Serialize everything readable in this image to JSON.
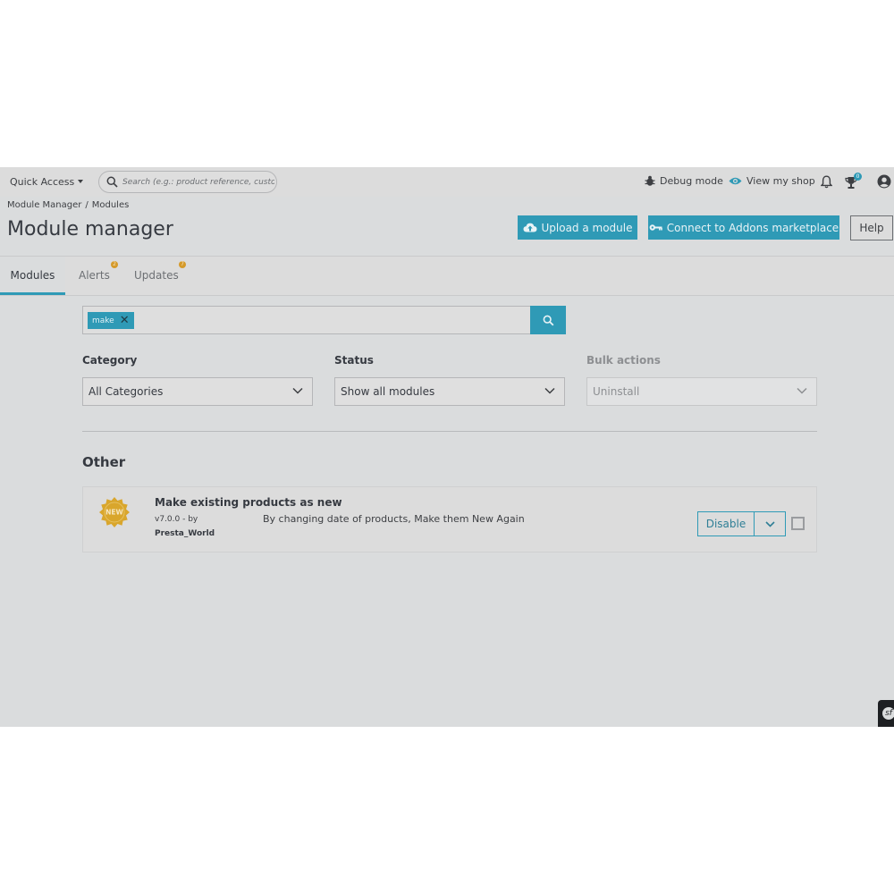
{
  "topbar": {
    "quick_access": "Quick Access",
    "search_placeholder": "Search (e.g.: product reference, custome",
    "debug_mode": "Debug mode",
    "view_shop": "View my shop",
    "trophy_badge": "0"
  },
  "header": {
    "breadcrumb": [
      "Module Manager",
      "Modules"
    ],
    "title": "Module manager",
    "upload_label": "Upload a module",
    "connect_label": "Connect to Addons marketplace",
    "help_label": "Help"
  },
  "tabs": [
    {
      "label": "Modules",
      "badge": ""
    },
    {
      "label": "Alerts",
      "badge": "2"
    },
    {
      "label": "Updates",
      "badge": "7"
    }
  ],
  "filter": {
    "chip": "make"
  },
  "filters": {
    "category_label": "Category",
    "category_value": "All Categories",
    "status_label": "Status",
    "status_value": "Show all modules",
    "bulk_label": "Bulk actions",
    "bulk_value": "Uninstall"
  },
  "section": {
    "title": "Other"
  },
  "module": {
    "logo_text": "NEW",
    "name": "Make existing products as new",
    "version": "v7.0.0 - by",
    "author": "Presta_World",
    "description": "By changing date of products, Make them New Again",
    "action_label": "Disable"
  },
  "colors": {
    "accent": "#2f9ab6",
    "badge_orange": "#d59a2a",
    "logo_gold": "#d9a62c"
  }
}
